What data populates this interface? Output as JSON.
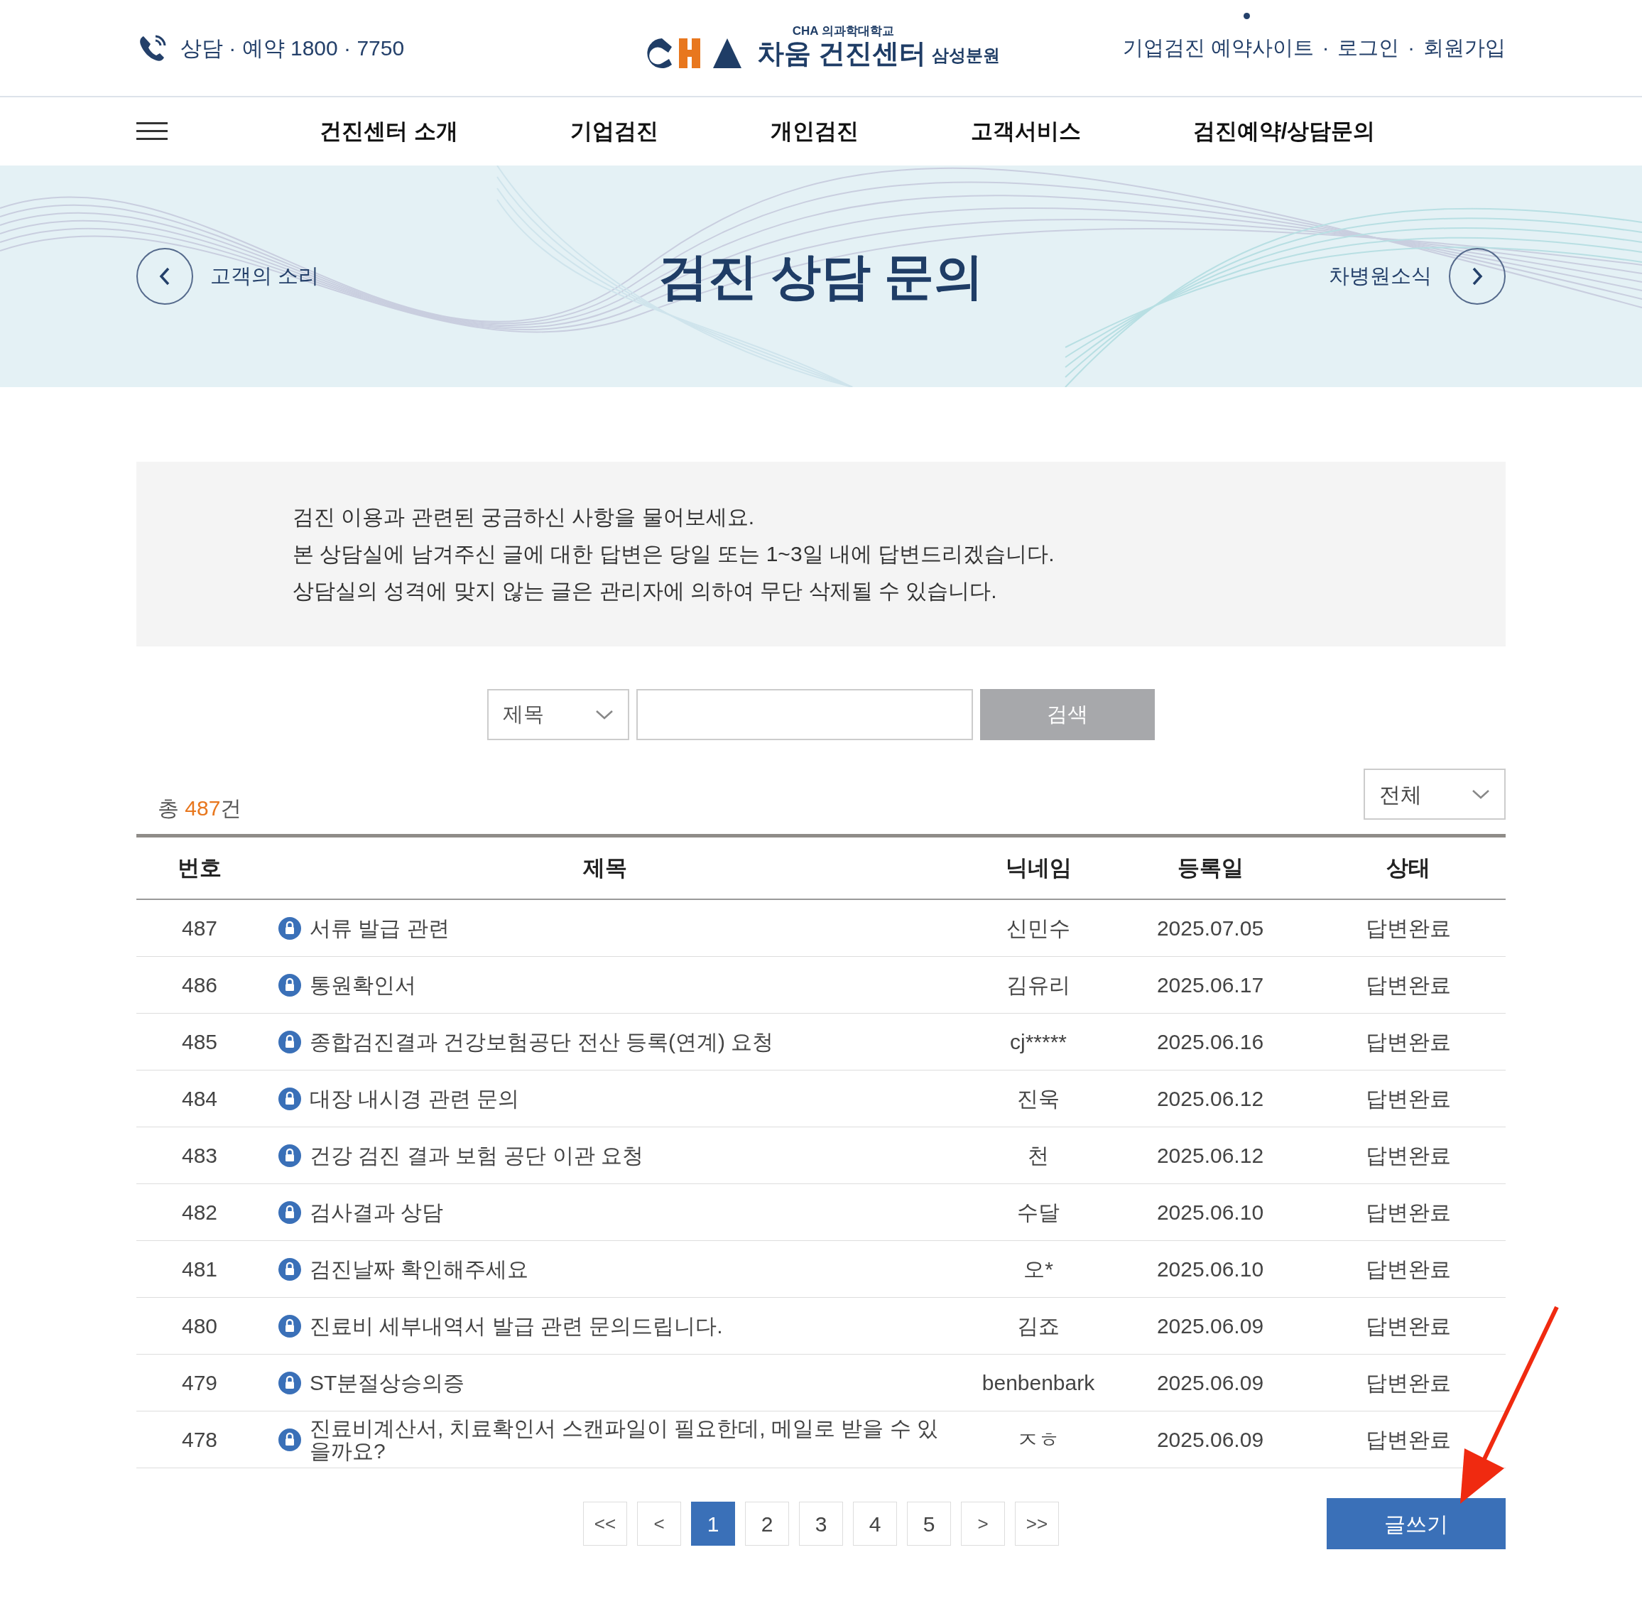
{
  "header": {
    "phone": "상담 · 예약 1800 · 7750",
    "logo_top": "CHA 의과학대학교",
    "logo_name": "차움 건진센터",
    "logo_branch": "삼성분원",
    "links": [
      "기업검진 예약사이트",
      "로그인",
      "회원가입"
    ],
    "separator": "·"
  },
  "nav": {
    "items": [
      "건진센터 소개",
      "기업검진",
      "개인검진",
      "고객서비스",
      "검진예약/상담문의"
    ]
  },
  "banner": {
    "prev": "고객의 소리",
    "title": "검진 상담 문의",
    "next": "차병원소식"
  },
  "notice": [
    "검진 이용과 관련된 궁금하신 사항을 물어보세요.",
    "본 상담실에 남겨주신 글에 대한 답변은 당일 또는 1~3일 내에 답변드리겠습니다.",
    "상담실의 성격에 맞지 않는 글은 관리자에 의하여 무단 삭제될 수 있습니다."
  ],
  "search": {
    "field": "제목",
    "button": "검색"
  },
  "total": {
    "prefix": "총 ",
    "count": "487",
    "suffix": "건"
  },
  "filter": "전체",
  "table": {
    "columns": [
      "번호",
      "제목",
      "닉네임",
      "등록일",
      "상태"
    ],
    "rows": [
      {
        "no": "487",
        "title": "서류 발급 관련",
        "locked": true,
        "nick": "신민수",
        "date": "2025.07.05",
        "status": "답변완료"
      },
      {
        "no": "486",
        "title": "통원확인서",
        "locked": true,
        "nick": "김유리",
        "date": "2025.06.17",
        "status": "답변완료"
      },
      {
        "no": "485",
        "title": "종합검진결과 건강보험공단 전산 등록(연계) 요청",
        "locked": true,
        "nick": "cj*****",
        "date": "2025.06.16",
        "status": "답변완료"
      },
      {
        "no": "484",
        "title": "대장 내시경 관련 문의",
        "locked": true,
        "nick": "진욱",
        "date": "2025.06.12",
        "status": "답변완료"
      },
      {
        "no": "483",
        "title": "건강 검진 결과 보험 공단 이관 요청",
        "locked": true,
        "nick": "천",
        "date": "2025.06.12",
        "status": "답변완료"
      },
      {
        "no": "482",
        "title": "검사결과 상담",
        "locked": true,
        "nick": "수달",
        "date": "2025.06.10",
        "status": "답변완료"
      },
      {
        "no": "481",
        "title": "검진날짜 확인해주세요",
        "locked": true,
        "nick": "오*",
        "date": "2025.06.10",
        "status": "답변완료"
      },
      {
        "no": "480",
        "title": "진료비 세부내역서 발급 관련 문의드립니다.",
        "locked": true,
        "nick": "김죠",
        "date": "2025.06.09",
        "status": "답변완료"
      },
      {
        "no": "479",
        "title": "ST분절상승의증",
        "locked": true,
        "nick": "benbenbark",
        "date": "2025.06.09",
        "status": "답변완료"
      },
      {
        "no": "478",
        "title": "진료비계산서, 치료확인서 스캔파일이 필요한데, 메일로 받을 수 있을까요?",
        "locked": true,
        "nick": "ㅈㅎ",
        "date": "2025.06.09",
        "status": "답변완료"
      }
    ]
  },
  "pagination": {
    "first": "<<",
    "prev": "<",
    "pages": [
      {
        "label": "1",
        "selected": true
      },
      {
        "label": "2",
        "selected": false
      },
      {
        "label": "3",
        "selected": false
      },
      {
        "label": "4",
        "selected": false
      },
      {
        "label": "5",
        "selected": false
      }
    ],
    "next": ">",
    "last": ">>"
  },
  "write_button": "글쓰기"
}
